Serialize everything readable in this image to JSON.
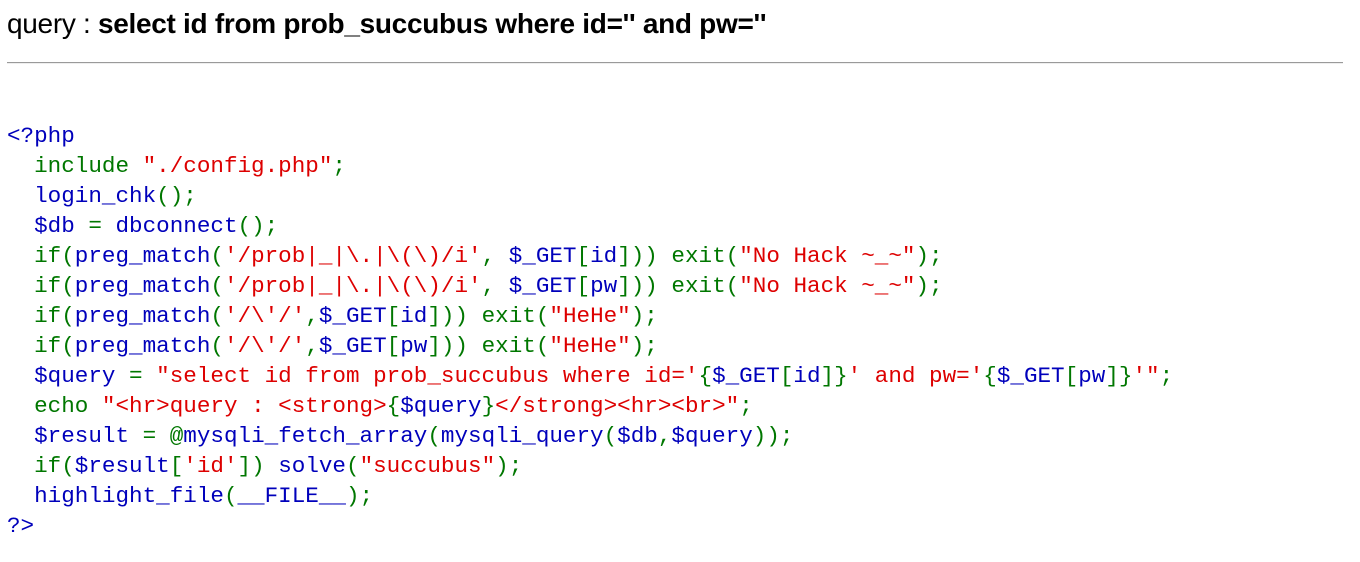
{
  "query_line": {
    "label": "query : ",
    "query": "select id from prob_succubus where id='' and pw=''"
  },
  "source_code": {
    "colors": {
      "keyword": "#007700",
      "string": "#DD0000",
      "default": "#0000BB"
    },
    "lines": [
      [
        [
          "d",
          "<?php"
        ]
      ],
      [
        [
          "k",
          "  include "
        ],
        [
          "s",
          "\"./config.php\""
        ],
        [
          "k",
          ";"
        ]
      ],
      [
        [
          "d",
          "  login_chk"
        ],
        [
          "k",
          "();"
        ]
      ],
      [
        [
          "d",
          "  $db "
        ],
        [
          "k",
          "= "
        ],
        [
          "d",
          "dbconnect"
        ],
        [
          "k",
          "();"
        ]
      ],
      [
        [
          "k",
          "  if("
        ],
        [
          "d",
          "preg_match"
        ],
        [
          "k",
          "("
        ],
        [
          "s",
          "'/prob|_|\\.|\\(\\)/i'"
        ],
        [
          "k",
          ", "
        ],
        [
          "d",
          "$_GET"
        ],
        [
          "k",
          "["
        ],
        [
          "d",
          "id"
        ],
        [
          "k",
          "])) exit("
        ],
        [
          "s",
          "\"No Hack ~_~\""
        ],
        [
          "k",
          ");"
        ]
      ],
      [
        [
          "k",
          "  if("
        ],
        [
          "d",
          "preg_match"
        ],
        [
          "k",
          "("
        ],
        [
          "s",
          "'/prob|_|\\.|\\(\\)/i'"
        ],
        [
          "k",
          ", "
        ],
        [
          "d",
          "$_GET"
        ],
        [
          "k",
          "["
        ],
        [
          "d",
          "pw"
        ],
        [
          "k",
          "])) exit("
        ],
        [
          "s",
          "\"No Hack ~_~\""
        ],
        [
          "k",
          ");"
        ]
      ],
      [
        [
          "k",
          "  if("
        ],
        [
          "d",
          "preg_match"
        ],
        [
          "k",
          "("
        ],
        [
          "s",
          "'/\\'/'"
        ],
        [
          "k",
          ","
        ],
        [
          "d",
          "$_GET"
        ],
        [
          "k",
          "["
        ],
        [
          "d",
          "id"
        ],
        [
          "k",
          "])) exit("
        ],
        [
          "s",
          "\"HeHe\""
        ],
        [
          "k",
          ");"
        ]
      ],
      [
        [
          "k",
          "  if("
        ],
        [
          "d",
          "preg_match"
        ],
        [
          "k",
          "("
        ],
        [
          "s",
          "'/\\'/'"
        ],
        [
          "k",
          ","
        ],
        [
          "d",
          "$_GET"
        ],
        [
          "k",
          "["
        ],
        [
          "d",
          "pw"
        ],
        [
          "k",
          "])) exit("
        ],
        [
          "s",
          "\"HeHe\""
        ],
        [
          "k",
          ");"
        ]
      ],
      [
        [
          "d",
          "  $query "
        ],
        [
          "k",
          "= "
        ],
        [
          "s",
          "\"select id from prob_succubus where id='"
        ],
        [
          "k",
          "{"
        ],
        [
          "d",
          "$_GET"
        ],
        [
          "k",
          "["
        ],
        [
          "d",
          "id"
        ],
        [
          "k",
          "]}"
        ],
        [
          "s",
          "' and pw='"
        ],
        [
          "k",
          "{"
        ],
        [
          "d",
          "$_GET"
        ],
        [
          "k",
          "["
        ],
        [
          "d",
          "pw"
        ],
        [
          "k",
          "]}"
        ],
        [
          "s",
          "'\""
        ],
        [
          "k",
          ";"
        ]
      ],
      [
        [
          "k",
          "  echo "
        ],
        [
          "s",
          "\"<hr>query : <strong>"
        ],
        [
          "k",
          "{"
        ],
        [
          "d",
          "$query"
        ],
        [
          "k",
          "}"
        ],
        [
          "s",
          "</strong><hr><br>\""
        ],
        [
          "k",
          ";"
        ]
      ],
      [
        [
          "d",
          "  $result "
        ],
        [
          "k",
          "= @"
        ],
        [
          "d",
          "mysqli_fetch_array"
        ],
        [
          "k",
          "("
        ],
        [
          "d",
          "mysqli_query"
        ],
        [
          "k",
          "("
        ],
        [
          "d",
          "$db"
        ],
        [
          "k",
          ","
        ],
        [
          "d",
          "$query"
        ],
        [
          "k",
          "));"
        ]
      ],
      [
        [
          "k",
          "  if("
        ],
        [
          "d",
          "$result"
        ],
        [
          "k",
          "["
        ],
        [
          "s",
          "'id'"
        ],
        [
          "k",
          "]) "
        ],
        [
          "d",
          "solve"
        ],
        [
          "k",
          "("
        ],
        [
          "s",
          "\"succubus\""
        ],
        [
          "k",
          ");"
        ]
      ],
      [
        [
          "d",
          "  highlight_file"
        ],
        [
          "k",
          "("
        ],
        [
          "d",
          "__FILE__"
        ],
        [
          "k",
          ");"
        ]
      ],
      [
        [
          "d",
          "?>"
        ]
      ]
    ]
  }
}
